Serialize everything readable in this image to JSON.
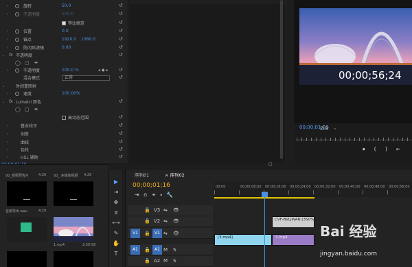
{
  "effect_controls": {
    "rows": [
      {
        "label": "旋转",
        "value": "50.0"
      },
      {
        "label": "不透明度",
        "value": "100.0"
      },
      {
        "label": "等比缩放",
        "checkbox": true
      },
      {
        "label": "位置",
        "value": "0.0"
      },
      {
        "label": "锚点",
        "value": "1920.0",
        "value2": "1080.0"
      },
      {
        "label": "防闪烁滤镜",
        "value": "0.00"
      },
      {
        "label": "不透明度",
        "section": true
      },
      {
        "label": "不透明度",
        "value": "100.0 %"
      },
      {
        "label": "混合模式",
        "select": "正常"
      },
      {
        "label": "时间重映射",
        "section": true
      },
      {
        "label": "速度",
        "value": "100.00%"
      },
      {
        "label": "Lumetri 颜色",
        "section": true
      },
      {
        "label": "高动态范围",
        "checkbox": false
      },
      {
        "label": "基本校正"
      },
      {
        "label": "创意"
      },
      {
        "label": "曲线"
      },
      {
        "label": "色轮"
      },
      {
        "label": "HSL 辅助"
      }
    ],
    "timecode": "00;00;01;16"
  },
  "monitor": {
    "timecode_overlay": "00;00;56;24",
    "current_tc": "00;00;01;21",
    "fit": "适合",
    "controls": [
      "⏺",
      "{",
      "}",
      "⇤"
    ]
  },
  "project": {
    "items": [
      {
        "name": "00_视频预告片",
        "len": "4:29"
      },
      {
        "name": "00_ 多媒体视频",
        "len": "4:29"
      },
      {
        "name": "音频导出.wav",
        "len": "4:29"
      },
      {
        "name": "1.mp4",
        "len": "2:59:58"
      }
    ]
  },
  "tools": [
    "▶",
    "⇥",
    "✥",
    "⧖",
    "⟷",
    "✎",
    "✋",
    "T"
  ],
  "timeline": {
    "tabs": [
      "序列01",
      "序列02"
    ],
    "timecode": "00;00;01;16",
    "ruler_labels": [
      "00;00",
      "00;00;08;00",
      "00;00;16;00",
      "00;00;24;00",
      "00;00;32;00",
      "00;00;40;00",
      "00;00;48;00",
      "00;00;56;00"
    ],
    "tracks": [
      {
        "name": "V3"
      },
      {
        "name": "V2"
      },
      {
        "name": "V1",
        "tag": "V1"
      },
      {
        "name": "A1",
        "tag": "A1"
      },
      {
        "name": "A2"
      }
    ],
    "clips": [
      {
        "label": "CVF-BVLJWAN [350%]",
        "color": "#c9c9c9"
      },
      {
        "label": "[3.mp4]",
        "color": "#8fd5ee"
      },
      {
        "label": "1.mp4",
        "color": "#9a7cc6"
      }
    ]
  },
  "watermark": {
    "brand": "Bai 经验",
    "url": "jingyan.baidu.com"
  }
}
